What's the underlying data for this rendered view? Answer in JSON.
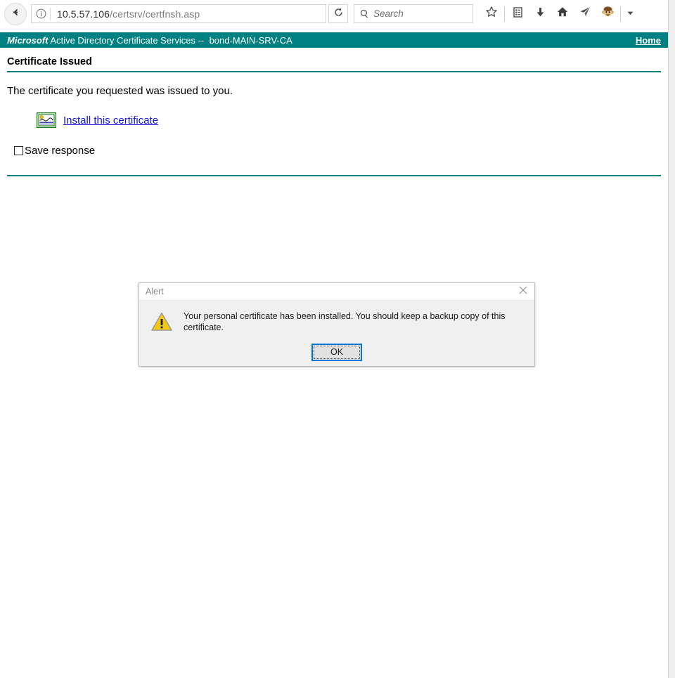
{
  "browser": {
    "back_icon": "back-arrow-icon",
    "info_icon": "site-info-icon",
    "url_host": "10.5.57.106",
    "url_path": "/certsrv/certfnsh.asp",
    "reload_icon": "reload-icon",
    "search_icon": "search-icon",
    "search_placeholder": "Search",
    "search_value": "",
    "toolbar_icons": [
      {
        "name": "bookmark-star-icon",
        "glyph": "star"
      },
      {
        "name": "library-icon",
        "glyph": "library"
      },
      {
        "name": "downloads-icon",
        "glyph": "download"
      },
      {
        "name": "home-icon",
        "glyph": "home"
      },
      {
        "name": "send-tab-icon",
        "glyph": "paper-plane"
      },
      {
        "name": "account-avatar-icon",
        "glyph": "monkey"
      }
    ],
    "chevron_icon": "chevron-down-icon",
    "menu_icon": "hamburger-menu-icon"
  },
  "site_header": {
    "brand": "Microsoft",
    "title": "Active Directory Certificate Services",
    "separator": "--",
    "ca_name": "bond-MAIN-SRV-CA",
    "home_link": "Home",
    "bar_color": "#008080"
  },
  "main": {
    "page_title": "Certificate Issued",
    "intro_text": "The certificate you requested was issued to you.",
    "certificate_icon": "certificate-icon",
    "install_link": "Install this certificate",
    "save_response_label": "Save response",
    "save_response_checked": false,
    "link_color": "#1414cc",
    "rule_color": "#008080"
  },
  "dialog": {
    "title": "Alert",
    "close_icon": "close-icon",
    "warning_icon": "warning-triangle-icon",
    "message": "Your personal certificate has been installed. You should keep a backup copy of this certificate.",
    "ok_label": "OK",
    "focus_color": "#0078d7"
  }
}
